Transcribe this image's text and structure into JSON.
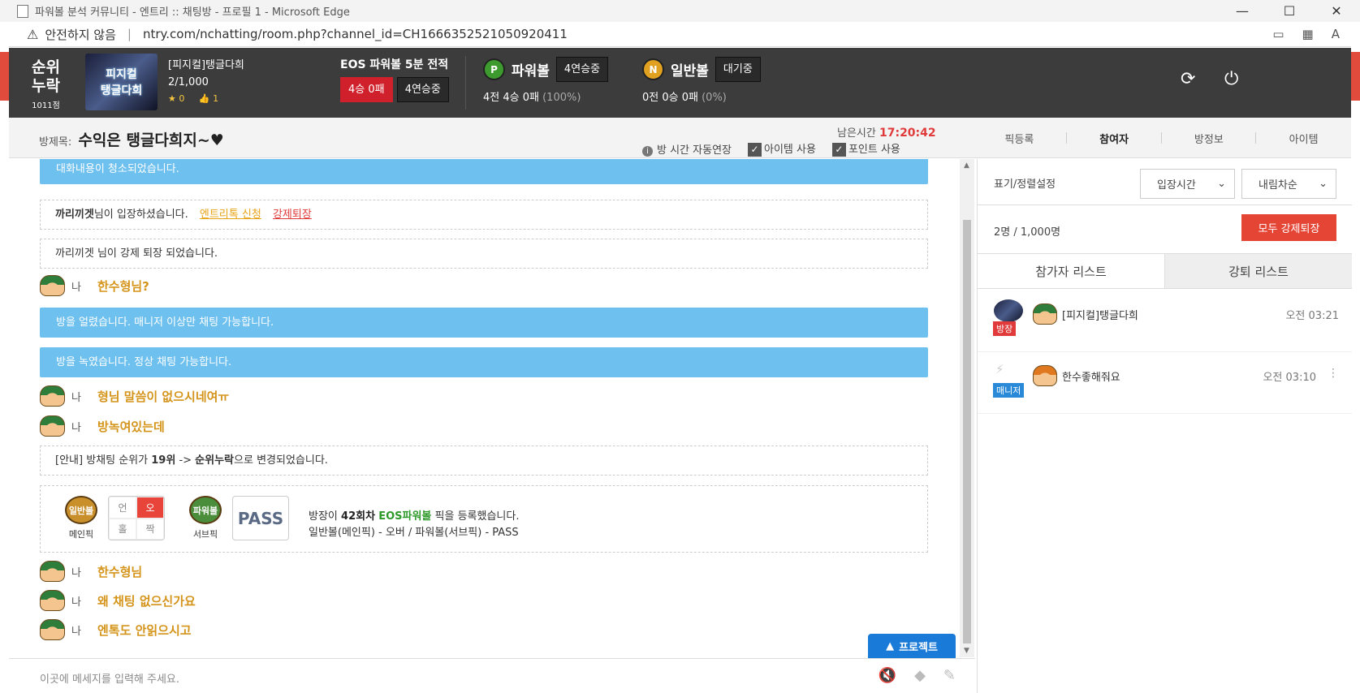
{
  "browser": {
    "title": "파워볼 분석 커뮤니티 - 엔트리 :: 채팅방 - 프로필 1 - Microsoft Edge",
    "insecure_label": "안전하지 않음",
    "url": "ntry.com/nchatting/room.php?channel_id=CH1666352521050920411"
  },
  "header": {
    "rank_line1": "순위",
    "rank_line2": "누락",
    "rank_points": "1011점",
    "logo_text1": "피지컬",
    "logo_text2": "탱글다희",
    "room_name": "[피지컬]탱글다희",
    "member_count": "2/1,000",
    "star_count": "0",
    "like_count": "1",
    "eos_title": "EOS 파워볼 5분 전적",
    "eos_record": "4승 0패",
    "eos_streak": "4연승중",
    "powerball_icon": "P",
    "powerball_name": "파워볼",
    "powerball_status": "4연승중",
    "powerball_record": "4전 4승 0패",
    "powerball_pct": "(100%)",
    "normal_icon": "N",
    "normal_name": "일반볼",
    "normal_status": "대기중",
    "normal_record": "0전 0승 0패",
    "normal_pct": "(0%)"
  },
  "subheader": {
    "room_title_label": "방제목:",
    "room_title": "수익은 탱글다희지~♥",
    "remain_label": "남은시간",
    "remain_time": "17:20:42",
    "auto_extend": "방 시간 자동연장",
    "item_use": "아이템 사용",
    "point_use": "포인트 사용",
    "tabs": [
      "픽등록",
      "참여자",
      "방정보",
      "아이템"
    ]
  },
  "chat": {
    "notice_cleared": "대화내용이 청소되었습니다.",
    "enter_user": "까리끼겟",
    "enter_text": "님이 입장하셨습니다.",
    "enter_link1": "엔트리톡 신청",
    "enter_link2": "강제퇴장",
    "kicked_text": "까리끼겟 님이 강제 퇴장 되었습니다.",
    "me_label": "나",
    "msg1": "한수형님?",
    "notice_frozen": "방을 얼렸습니다. 매니저 이상만 채팅 가능합니다.",
    "notice_thawed": "방을 녹였습니다. 정상 채팅 가능합니다.",
    "msg2": "형님 말씀이 없으시네여ㅠ",
    "msg3": "방녹여있는데",
    "rank_notice_pre": "[안내] 방채팅 순위가",
    "rank_notice_from": "19위",
    "rank_notice_arrow": "->",
    "rank_notice_to": "순위누락",
    "rank_notice_post": "으로 변경되었습니다.",
    "pick": {
      "main_coin": "일반볼",
      "main_label": "메인픽",
      "grid": [
        "언",
        "오",
        "홀",
        "짝"
      ],
      "sub_coin": "파워볼",
      "sub_label": "서브픽",
      "pass": "PASS",
      "line1_pre": "방장이",
      "line1_round": "42회차",
      "line1_game": "EOS파워볼",
      "line1_post": "픽을 등록했습니다.",
      "line2": "일반볼(메인픽) - 오버 / 파워볼(서브픽) - PASS"
    },
    "msg4": "한수형님",
    "msg5": "왜 채팅 없으신가요",
    "msg6": "엔톡도 안읽으시고",
    "protect_label": "프로젝트",
    "input_placeholder": "이곳에 메세지를 입력해 주세요."
  },
  "rpanel": {
    "sort_label": "표기/정렬설정",
    "sort_option": "입장시간",
    "order_option": "내림차순",
    "count": "2명 / 1,000명",
    "kick_all": "모두 강제퇴장",
    "tab_participants": "참가자 리스트",
    "tab_kicked": "강퇴 리스트",
    "participants": [
      {
        "name": "[피지컬]탱글다희",
        "role": "방장",
        "time": "오전 03:21"
      },
      {
        "name": "한수좋해줘요",
        "role": "매니저",
        "time": "오전 03:10"
      }
    ]
  }
}
